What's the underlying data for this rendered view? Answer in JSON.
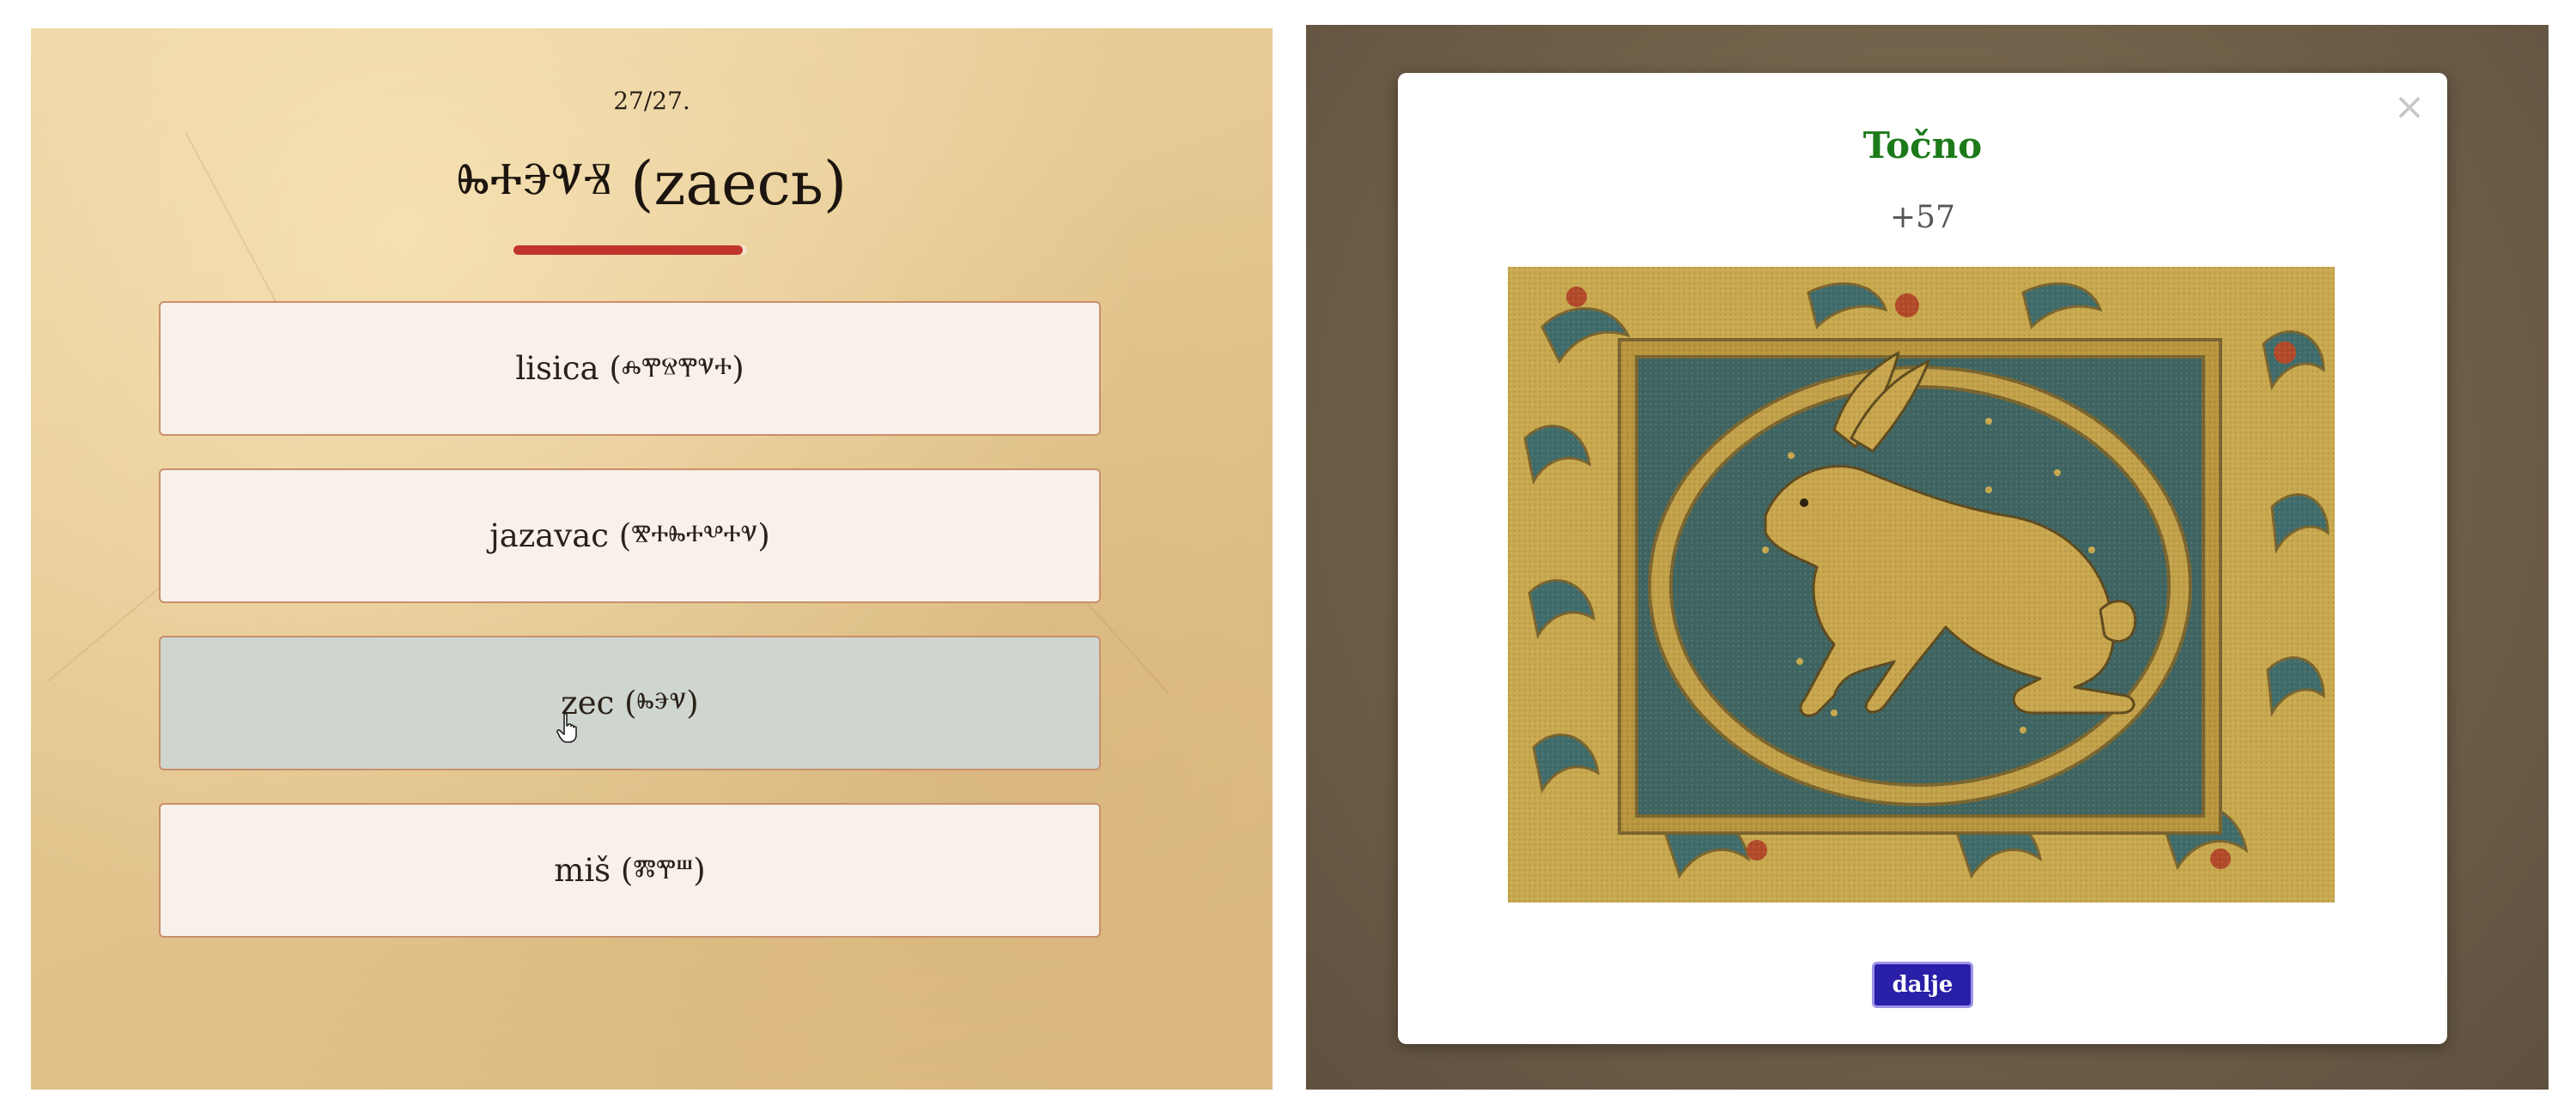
{
  "quiz": {
    "counter": "27/27.",
    "question": "ⰸⰰⰵⱌⱐ (zaecь)",
    "progress": 0.98,
    "options": [
      {
        "label": "lisica (ⰾⰹⱄⰹⱌⰰ)"
      },
      {
        "label": "jazavac (ⰺⰰⰸⰰⰲⰰⱌ)"
      },
      {
        "label": "zec (ⰸⰵⱌ)"
      },
      {
        "label": "miš (ⰿⰹⱎ)"
      }
    ],
    "hovered_option_index": 2
  },
  "modal": {
    "title": "Točno",
    "close_icon": "×",
    "score": "+57",
    "illustration": "hare-illuminated-manuscript",
    "next_button": "dalje"
  },
  "colors": {
    "title_green": "#1d7a1a",
    "progress_red": "#c0352b",
    "button_blue": "#2a1fa8",
    "option_hover": "#cfd6cf"
  }
}
